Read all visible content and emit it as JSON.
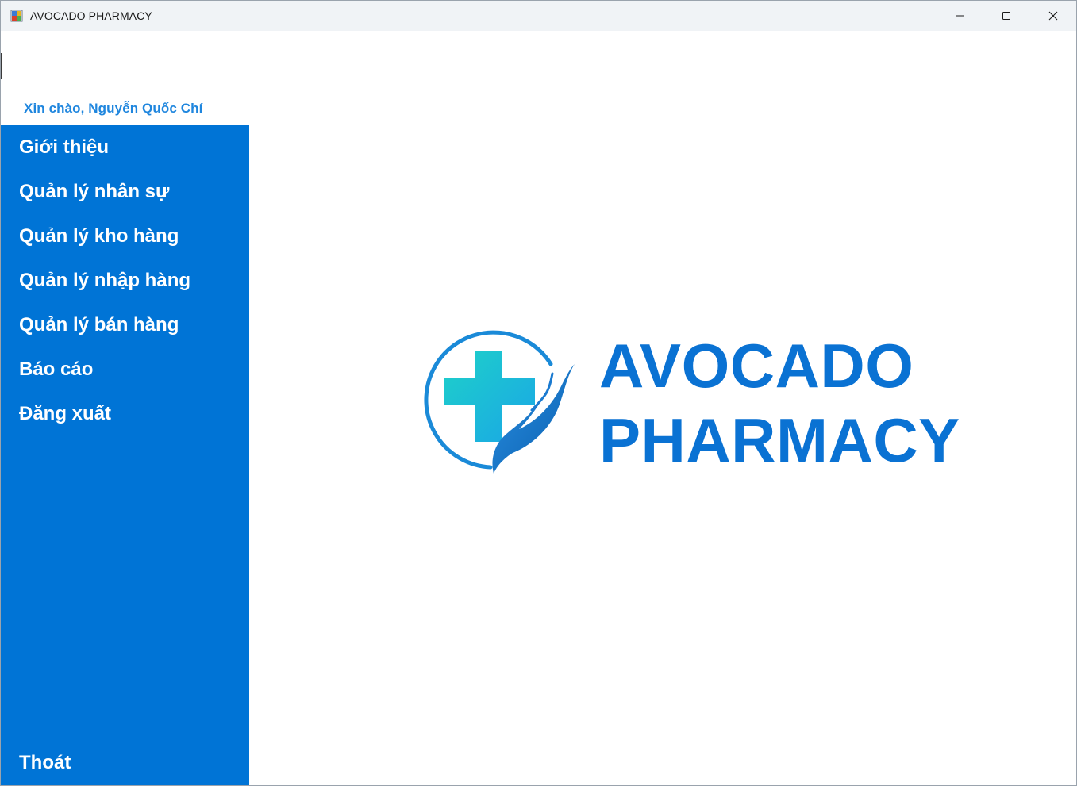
{
  "window": {
    "title": "AVOCADO PHARMACY",
    "controls": {
      "minimize_icon": "minimize-icon",
      "maximize_icon": "maximize-icon",
      "close_icon": "close-icon"
    }
  },
  "header": {
    "greeting": "Xin chào, Nguyễn Quốc Chí"
  },
  "sidebar": {
    "items": [
      {
        "label": "Giới thiệu"
      },
      {
        "label": "Quản lý nhân sự"
      },
      {
        "label": "Quản lý kho hàng"
      },
      {
        "label": "Quản lý nhập hàng"
      },
      {
        "label": "Quản lý bán hàng"
      },
      {
        "label": "Báo cáo"
      },
      {
        "label": "Đăng xuất"
      }
    ],
    "exit_label": "Thoát"
  },
  "main": {
    "brand_line1": "AVOCADO",
    "brand_line2": "PHARMACY",
    "logo_icon": "medical-cross-hand-icon"
  },
  "colors": {
    "sidebar_bg": "#0074d6",
    "greeting": "#1f86de",
    "brand": "#0a72d3",
    "cross": "#22c7cf"
  }
}
